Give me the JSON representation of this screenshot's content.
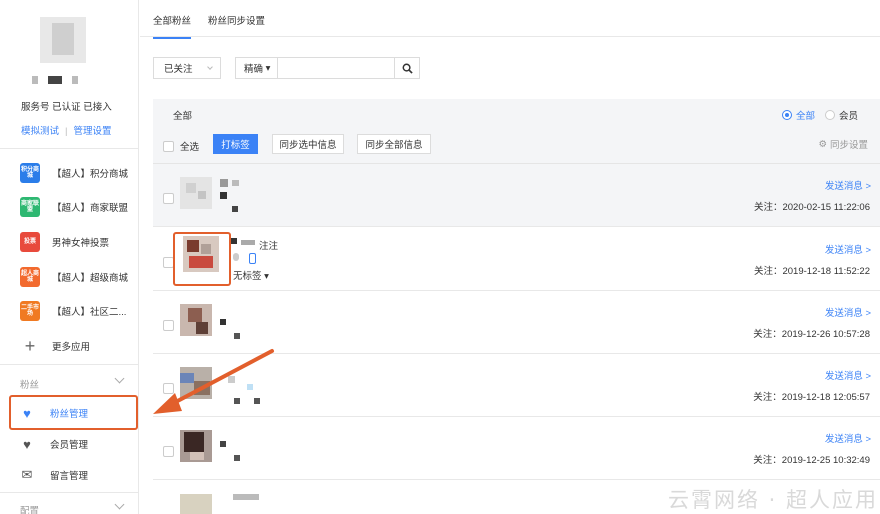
{
  "sidebar": {
    "account_type": "服务号 已认证 已接入",
    "link_test": "模拟测试",
    "link_manage": "管理设置",
    "apps": [
      {
        "label": "【超人】积分商城",
        "icon_text": "积分商城",
        "color": "#2b7de9"
      },
      {
        "label": "【超人】商家联盟",
        "icon_text": "商家联盟",
        "color": "#2eb872"
      },
      {
        "label": "男神女神投票",
        "icon_text": "投票",
        "color": "#e84a3c"
      },
      {
        "label": "【超人】超级商城",
        "icon_text": "超人商城",
        "color": "#f26a2e"
      },
      {
        "label": "【超人】社区二...",
        "icon_text": "二手市场",
        "color": "#f07a22"
      }
    ],
    "more_apps": "更多应用",
    "group_fans": "粉丝",
    "menu": [
      {
        "label": "粉丝管理",
        "icon": "heart-icon",
        "active": true
      },
      {
        "label": "会员管理",
        "icon": "heart-icon",
        "active": false
      },
      {
        "label": "留言管理",
        "icon": "mail-icon",
        "active": false
      }
    ],
    "group_config": "配置"
  },
  "tabs": [
    {
      "label": "全部粉丝",
      "active": true
    },
    {
      "label": "粉丝同步设置",
      "active": false
    }
  ],
  "filter": {
    "status": "已关注",
    "mode": "精确",
    "search_value": "",
    "search_placeholder": ""
  },
  "list_header": {
    "all_label": "全部",
    "radio_all": "全部",
    "radio_member": "会员",
    "select_all": "全选",
    "tag_button": "打标签",
    "sync_selected": "同步选中信息",
    "sync_all": "同步全部信息",
    "sync_settings": "同步设置"
  },
  "rows": [
    {
      "send": "发送消息 >",
      "follow": "关注：2020-02-15 11:22:06"
    },
    {
      "send": "发送消息 >",
      "follow": "关注：2019-12-18 11:52:22",
      "remark": "注注",
      "tag": "无标签 ▾"
    },
    {
      "send": "发送消息 >",
      "follow": "关注：2019-12-26 10:57:28"
    },
    {
      "send": "发送消息 >",
      "follow": "关注：2019-12-18 12:05:57"
    },
    {
      "send": "发送消息 >",
      "follow": "关注：2019-12-25 10:32:49"
    }
  ],
  "watermark": "云霄网络 · 超人应用",
  "colors": {
    "accent": "#3b82f6",
    "highlight": "#e25f2c"
  }
}
